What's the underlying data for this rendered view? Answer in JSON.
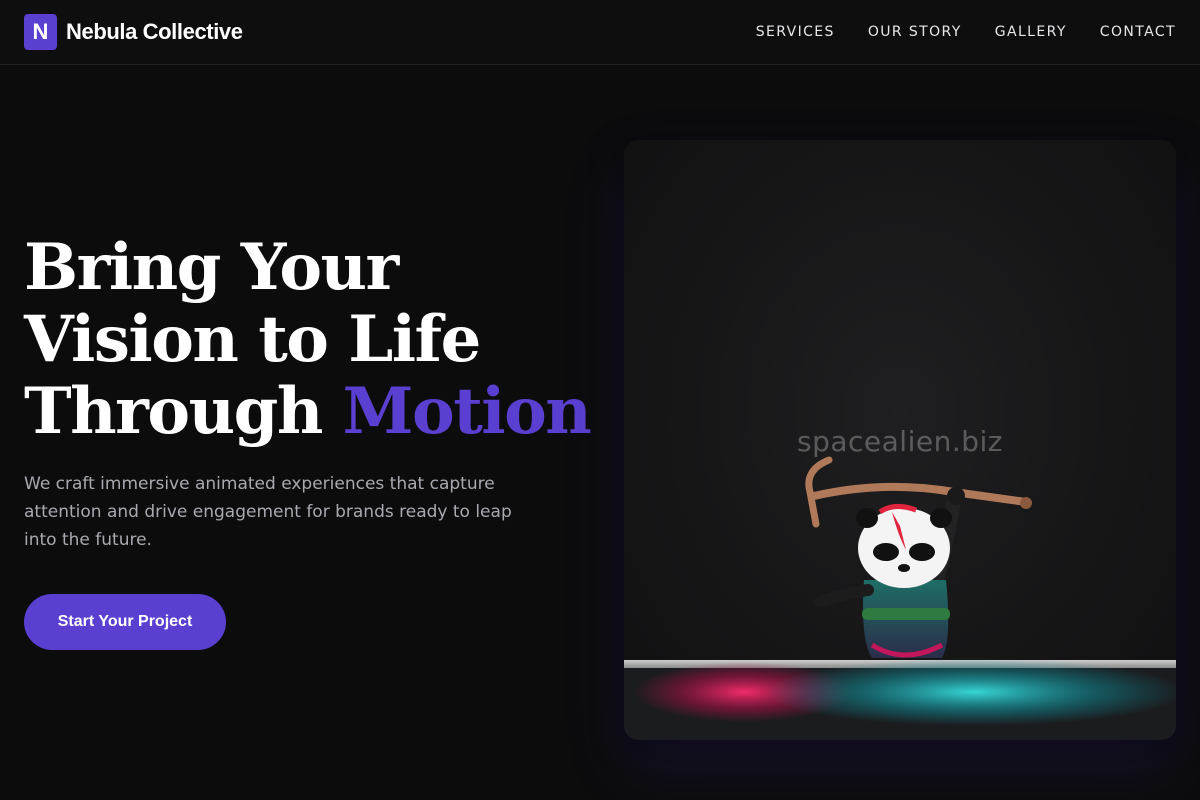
{
  "brand": {
    "logo_letter": "N",
    "name": "Nebula Collective",
    "accent_color": "#5a3fd0"
  },
  "nav": {
    "items": [
      {
        "label": "SERVICES"
      },
      {
        "label": "OUR STORY"
      },
      {
        "label": "GALLERY"
      },
      {
        "label": "CONTACT"
      }
    ]
  },
  "hero": {
    "title_line1": "Bring Your",
    "title_line2": "Vision to Life",
    "title_line3_prefix": "Through",
    "title_accent": "Motion",
    "subtitle": "We craft immersive animated experiences that capture attention and drive engagement for brands ready to leap into the future.",
    "cta_label": "Start Your Project"
  },
  "media": {
    "watermark": "spacealien.biz",
    "image_subject": "panda-figurine-photo"
  }
}
